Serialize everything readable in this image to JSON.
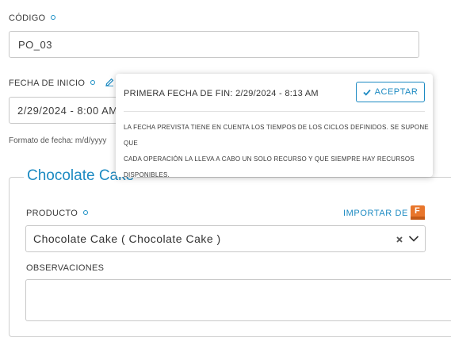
{
  "codigo": {
    "label": "CÓDIGO",
    "value": "PO_03"
  },
  "fecha_inicio": {
    "label": "FECHA DE INICIO",
    "value": "2/29/2024 - 8:00 AM",
    "hint": "Formato de fecha: m/d/yyyy"
  },
  "popover": {
    "title": "PRIMERA FECHA DE FIN: 2/29/2024 - 8:13 AM",
    "accept_label": "ACEPTAR",
    "note_lines": [
      "LA FECHA PREVISTA TIENE EN CUENTA LOS TIEMPOS DE LOS CICLOS DEFINIDOS. SE SUPONE QUE",
      "CADA OPERACIÓN LA LLEVA A CABO UN SOLO RECURSO Y QUE SIEMPRE HAY RECURSOS",
      "DISPONIBLES."
    ]
  },
  "section": {
    "legend": "Chocolate Cake",
    "producto": {
      "label": "PRODUCTO",
      "value": "Chocolate Cake ( Chocolate Cake )"
    },
    "import_label": "IMPORTAR DE",
    "import_badge": "F",
    "observaciones": {
      "label": "OBSERVACIONES",
      "value": ""
    }
  },
  "colors": {
    "accent": "#1c8ac2",
    "badge": "#e8762c"
  },
  "icons": {
    "required": "required-dot-icon",
    "edit": "pencil-icon",
    "check": "check-icon",
    "clear": "close-icon",
    "dropdown": "chevron-down-icon",
    "import": "fusion-logo-icon"
  }
}
